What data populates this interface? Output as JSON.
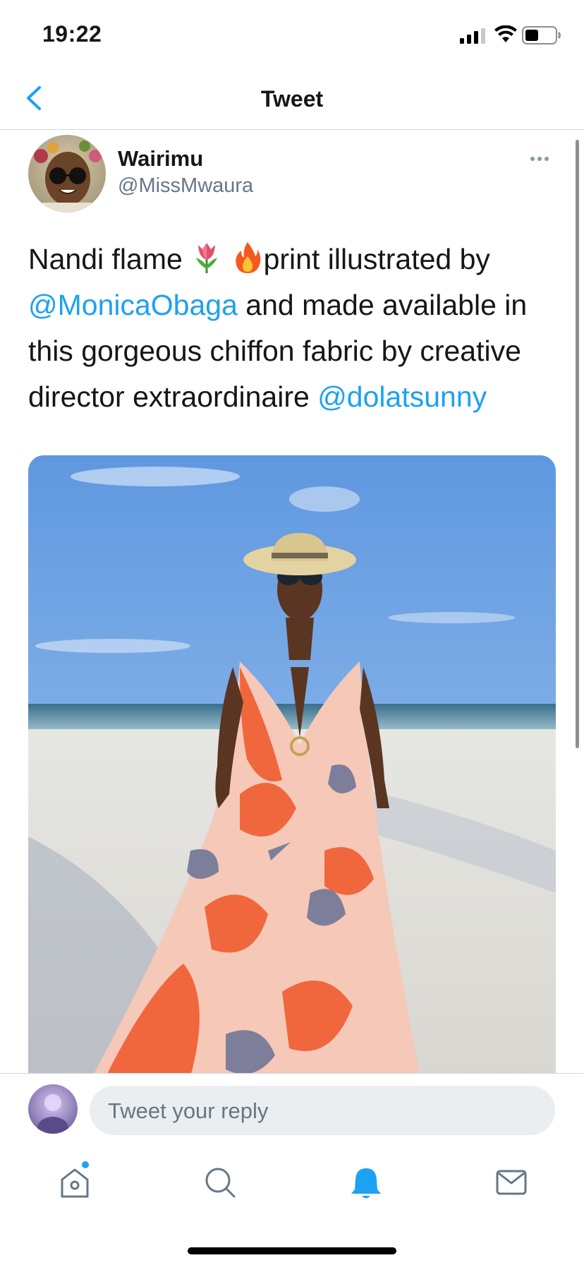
{
  "status_bar": {
    "time": "19:22"
  },
  "header": {
    "title": "Tweet"
  },
  "tweet": {
    "author_name": "Wairimu",
    "author_handle": "@MissMwaura",
    "text_part1": "Nandi flame ",
    "text_part2": "print illustrated by ",
    "mention1": "@MonicaObaga",
    "text_part3": " and made available in this gorgeous chiffon fabric by creative director extraordinaire ",
    "mention2": "@dolatsunny",
    "emojis": [
      "tulip-icon",
      "fire-icon"
    ]
  },
  "reply": {
    "placeholder": "Tweet your reply"
  },
  "tab_bar": {
    "tabs": [
      "home-icon",
      "search-icon",
      "notifications-icon",
      "messages-icon"
    ],
    "active": "notifications",
    "accent_color": "#1da1f2"
  },
  "colors": {
    "link": "#1da1f2",
    "secondary": "#657786"
  }
}
